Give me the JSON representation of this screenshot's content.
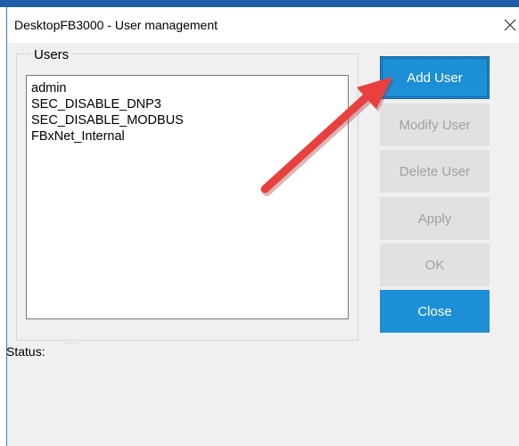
{
  "window": {
    "title": "DesktopFB3000 - User management",
    "close_icon": "close-icon"
  },
  "users_group": {
    "label": "Users",
    "items": [
      "admin",
      "SEC_DISABLE_DNP3",
      "SEC_DISABLE_MODBUS",
      "FBxNet_Internal"
    ]
  },
  "buttons": {
    "add_user": "Add User",
    "modify_user": "Modify User",
    "delete_user": "Delete User",
    "apply": "Apply",
    "ok": "OK",
    "close": "Close"
  },
  "status": {
    "label": "Status:",
    "value": ""
  },
  "annotation": {
    "type": "arrow",
    "icon": "red-arrow-icon",
    "points_to": "add-user-button",
    "color": "#e8403f"
  },
  "colors": {
    "accent_button": "#1c8fd6",
    "disabled_button": "#e1e1e1",
    "disabled_text": "#a0a0a0",
    "dialog_background": "#f0f0f0",
    "window_border": "#3c7fc4"
  }
}
